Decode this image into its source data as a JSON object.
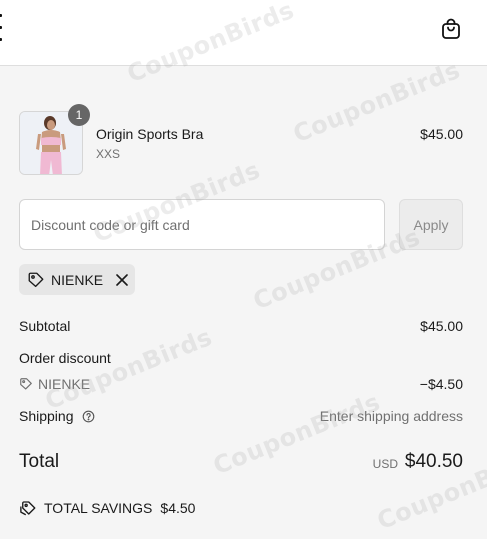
{
  "cart_item": {
    "name": "Origin Sports Bra",
    "variant": "XXS",
    "price": "$45.00",
    "quantity": "1"
  },
  "discount": {
    "placeholder": "Discount code or gift card",
    "apply_label": "Apply",
    "applied_code": "NIENKE"
  },
  "summary": {
    "subtotal_label": "Subtotal",
    "subtotal_value": "$45.00",
    "order_discount_label": "Order discount",
    "discount_code": "NIENKE",
    "discount_value": "−$4.50",
    "shipping_label": "Shipping",
    "shipping_value": "Enter shipping address",
    "total_label": "Total",
    "total_currency": "USD",
    "total_value": "$40.50",
    "savings_label": "TOTAL SAVINGS",
    "savings_value": "$4.50"
  },
  "watermark": "CouponBirds",
  "icons": {
    "menu": "menu-icon",
    "cart": "shopping-bag-icon",
    "tag": "tag-icon",
    "remove": "close-icon",
    "help": "help-circle-icon"
  },
  "colors": {
    "background": "#f5f5f5",
    "header": "#ffffff",
    "text": "#1a1a1a",
    "muted": "#707070",
    "badge": "#666666",
    "chip": "#e6e6e6",
    "apply_button": "#ececec"
  }
}
